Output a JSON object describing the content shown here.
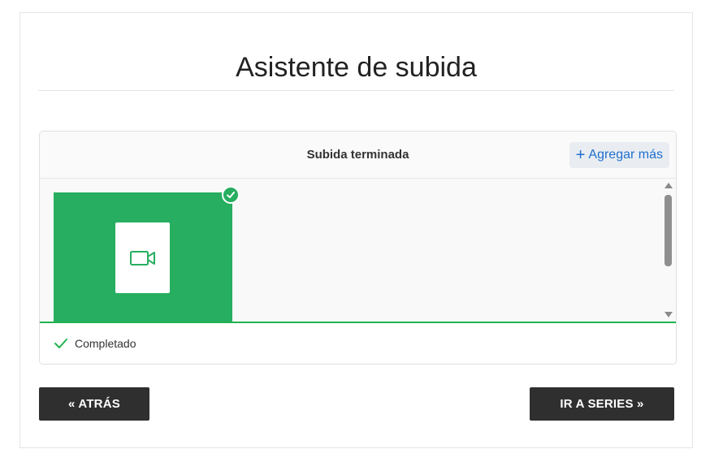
{
  "page": {
    "title": "Asistente de subida"
  },
  "uploader": {
    "header_title": "Subida terminada",
    "add_more_label": "Agregar más",
    "status_text": "Completado",
    "file": {
      "type_icon": "video-camera-icon",
      "state": "complete"
    }
  },
  "navigation": {
    "back_label": "« ATRÁS",
    "next_label": "IR A SERIES »"
  },
  "colors": {
    "accent_green": "#27ae60",
    "link_blue": "#1f6fce",
    "button_dark": "#2f2f2f"
  }
}
